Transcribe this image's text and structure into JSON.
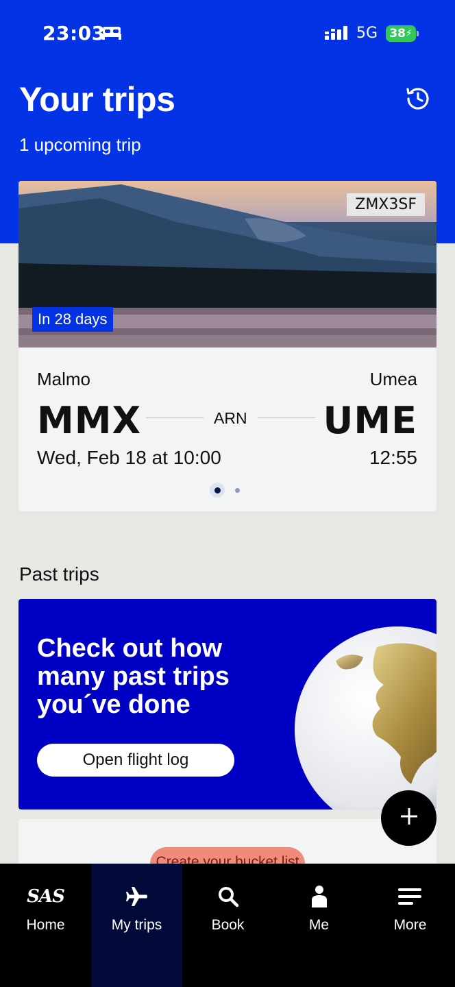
{
  "status_bar": {
    "time": "23:03",
    "network": "5G",
    "battery": "38"
  },
  "header": {
    "title": "Your trips",
    "subtitle": "1 upcoming trip",
    "history_icon": "history-clock-icon"
  },
  "upcoming_trip": {
    "booking_reference": "ZMX3SF",
    "countdown": "In 28 days",
    "origin_city": "Malmo",
    "origin_code": "MMX",
    "destination_city": "Umea",
    "destination_code": "UME",
    "via": "ARN",
    "departure": "Wed, Feb 18 at 10:00",
    "arrival": "12:55",
    "pager": {
      "pages": 2,
      "active": 1
    }
  },
  "past_trips": {
    "section_title": "Past trips",
    "promo_text": "Check out how many past trips you´ve done",
    "promo_button": "Open flight log",
    "bucket_button": "Create your bucket list"
  },
  "tabs": [
    {
      "label": "Home",
      "icon": "sas-logo-icon",
      "logo_text": "SAS",
      "active": false
    },
    {
      "label": "My trips",
      "icon": "airplane-icon",
      "active": true
    },
    {
      "label": "Book",
      "icon": "search-icon",
      "active": false
    },
    {
      "label": "Me",
      "icon": "person-icon",
      "active": false
    },
    {
      "label": "More",
      "icon": "menu-icon",
      "active": false
    }
  ],
  "colors": {
    "brand_blue": "#0433e6",
    "promo_blue": "#0000c4",
    "tab_bar": "#000000",
    "active_tab": "#020a3a",
    "bucket_button": "#f08a7a"
  }
}
